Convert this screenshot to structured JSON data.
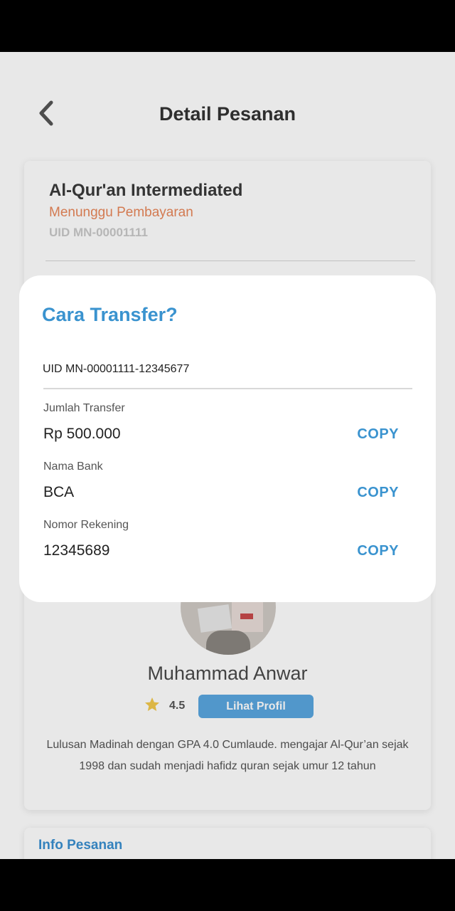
{
  "header": {
    "title": "Detail Pesanan"
  },
  "order": {
    "course_title": "Al-Qur'an Intermediated",
    "status": "Menunggu Pembayaran",
    "uid": "UID MN-00001111"
  },
  "teacher": {
    "name": "Muhammad Anwar",
    "rating": "4.5",
    "profile_button": "Lihat Profil",
    "description": "Lulusan Madinah dengan GPA 4.0 Cumlaude. mengajar Al-Qur’an sejak 1998 dan sudah menjadi hafidz quran sejak umur 12 tahun"
  },
  "info_section": {
    "title": "Info Pesanan"
  },
  "modal": {
    "title": "Cara Transfer?",
    "uid": "UID MN-00001111-12345677",
    "fields": [
      {
        "label": "Jumlah Transfer",
        "value": "Rp 500.000",
        "action": "COPY"
      },
      {
        "label": "Nama Bank",
        "value": "BCA",
        "action": "COPY"
      },
      {
        "label": "Nomor Rekening",
        "value": "12345689",
        "action": "COPY"
      }
    ]
  },
  "colors": {
    "accent": "#3a93cf",
    "status": "#e8875a",
    "star": "#f2c94c"
  },
  "icons": {
    "back": "chevron-left-icon",
    "star": "star-icon"
  }
}
